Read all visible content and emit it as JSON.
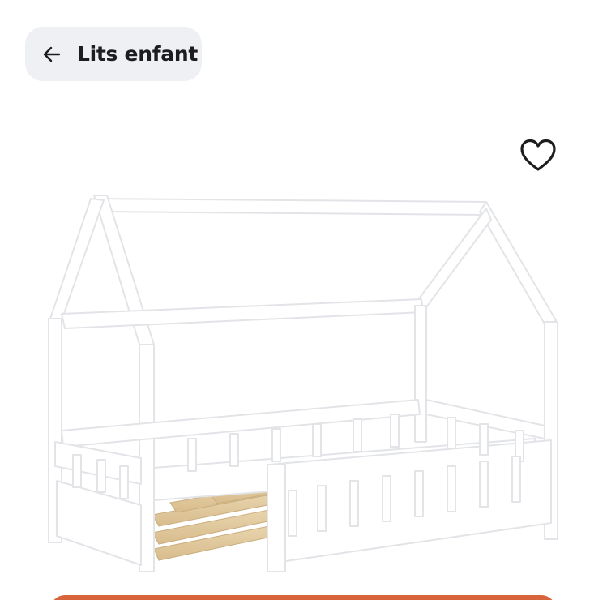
{
  "header": {
    "back_label": "Lits enfant",
    "back_icon": "arrow-left-icon"
  },
  "product": {
    "favorite_icon": "heart-outline-icon",
    "image": "white-house-frame-kids-bed-with-slats"
  },
  "colors": {
    "chip_background": "#eef0f4",
    "text": "#1d1d1f",
    "cta": "#d8643c"
  }
}
